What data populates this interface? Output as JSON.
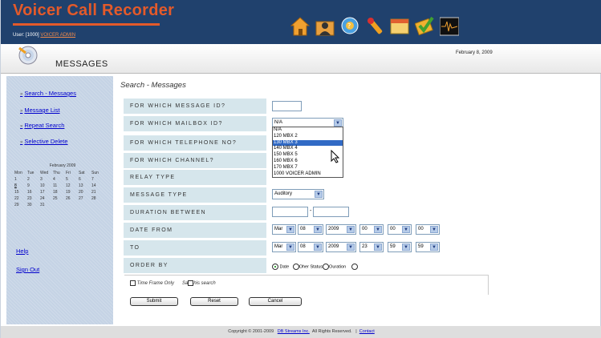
{
  "header": {
    "app_title": "Voicer Call Recorder",
    "user_prefix": "User: [1000]",
    "user_link": "VOICER ADMIN",
    "toolbar": [
      {
        "icon": "home-icon",
        "color": "#f0a030"
      },
      {
        "icon": "user-folder-icon",
        "color": "#e8a040"
      },
      {
        "icon": "globe-help-icon",
        "color": "#4aa0e0"
      },
      {
        "icon": "tools-icon",
        "color": "#f0a020"
      },
      {
        "icon": "calendar-icon",
        "color": "#f5d070"
      },
      {
        "icon": "chat-check-icon",
        "color": "#40a030"
      },
      {
        "icon": "waveform-monitor-icon",
        "color": "#101010"
      }
    ],
    "page_title": "MESSAGES",
    "date": "February 8, 2009"
  },
  "sidebar": {
    "items": [
      {
        "label": "Search - Messages",
        "bullet": "»"
      },
      {
        "label": "Message List",
        "bullet": "»"
      },
      {
        "label": "Repeat Search",
        "bullet": "»"
      },
      {
        "label": "Selective Delete",
        "bullet": "»"
      }
    ],
    "calendar": {
      "title": "February 2009",
      "weekdays": [
        "Mon",
        "Tue",
        "Wed",
        "Thu",
        "Fri",
        "Sat",
        "Sun"
      ],
      "days": [
        "1",
        "2",
        "3",
        "4",
        "5",
        "6",
        "7",
        "8",
        "9",
        "10",
        "11",
        "12",
        "13",
        "14",
        "15",
        "16",
        "17",
        "18",
        "19",
        "20",
        "21",
        "22",
        "23",
        "24",
        "25",
        "26",
        "27",
        "28",
        "29",
        "30",
        "31"
      ],
      "underlined_day": "8"
    },
    "help": "Help",
    "sign_out": "Sign Out"
  },
  "search": {
    "title": "Search - Messages",
    "labels": {
      "message_id": "FOR WHICH MESSAGE ID?",
      "mailbox_id": "FOR WHICH MAILBOX ID?",
      "telephone": "FOR WHICH TELEPHONE NO?",
      "channel": "FOR WHICH CHANNEL?",
      "relay_type": "RELAY TYPE",
      "message_type": "MESSAGE TYPE",
      "duration": "DURATION BETWEEN",
      "date_from": "DATE FROM",
      "to": "TO",
      "order_by": "ORDER BY"
    },
    "message_id_value": "",
    "mailbox_selected": "N/A",
    "mailbox_options": [
      "N/A",
      "120 MBX 2",
      "130 MBX 3",
      "140 MBX 4",
      "150 MBX 5",
      "160 MBX 6",
      "170 MBX 7",
      "1000 VOICER ADMIN"
    ],
    "mailbox_highlighted": "130 MBX 3",
    "message_type": "Auditory",
    "duration_sep": "-",
    "date_from": {
      "month": "Mar",
      "day": "08",
      "year": "2009",
      "hour": "00",
      "min": "00",
      "sec": "00"
    },
    "date_to": {
      "month": "Mar",
      "day": "08",
      "year": "2009",
      "hour": "23",
      "min": "59",
      "sec": "59"
    },
    "order_by": {
      "date": "Date",
      "other": "Oher",
      "status": "Status",
      "duration": "Ouration"
    },
    "time_frame_only": "Time Frame Only",
    "save_prefix": "Sa",
    "save_suffix": "his search",
    "submit": "Submit",
    "reset": "Reset",
    "cancel": "Cancel"
  },
  "footer": {
    "copyright": "Copyright  © 2001-2009",
    "company": "DB Streams Inc.",
    "rights": "All Rights Reserved.",
    "sep": "|",
    "contact": "Contact"
  }
}
